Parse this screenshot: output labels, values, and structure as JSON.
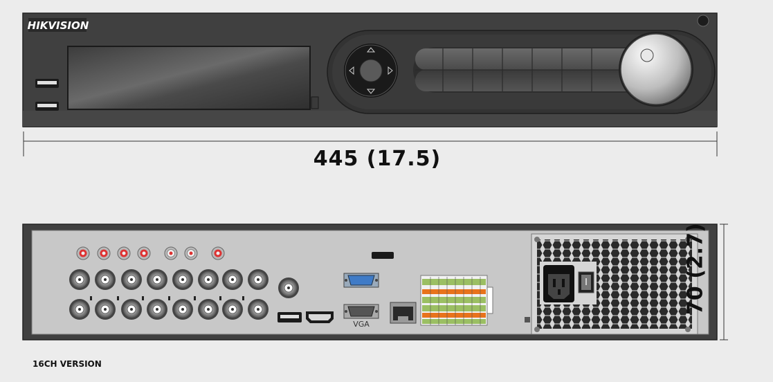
{
  "front_panel": {
    "brand": "HIKVISION",
    "width_dimension": "445 (17.5)"
  },
  "rear_panel": {
    "height_dimension": "70 (2.7)",
    "vga_label": "VGA",
    "version_label": "16CH VERSION"
  },
  "colors": {
    "chassis_front": "#404040",
    "rear_face": "#c8c8c8",
    "vga_blue": "#3f7bc7",
    "terminal_green": "#9bbf63",
    "terminal_orange": "#e8731c"
  }
}
